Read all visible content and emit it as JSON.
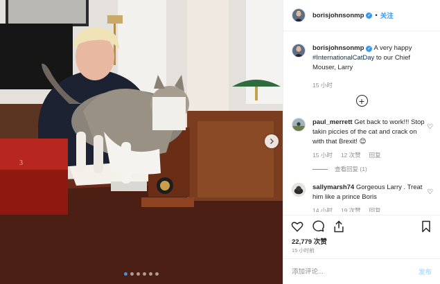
{
  "header": {
    "username": "borisjohnsonmp",
    "separator": "•",
    "follow_label": "关注"
  },
  "caption": {
    "username": "borisjohnsonmp",
    "text_before": "A very happy ",
    "hashtag": "#InternationalCatDay",
    "text_after": " to our Chief Mouser, Larry",
    "time": "15 小时"
  },
  "comments": [
    {
      "username": "paul_merrett",
      "text": "Get back to work!!! Stop takin piccies of the cat and crack on with that Brexit! ",
      "emoji": "😊",
      "time": "15 小时",
      "likes": "12 次赞",
      "reply_label": "回复",
      "view_replies": "查看回复 (1)"
    },
    {
      "username": "sallymarsh74",
      "text": "Gorgeous Larry . Treat him like a prince Boris",
      "time": "14 小时",
      "likes": "19 次赞",
      "reply_label": "回复"
    }
  ],
  "stats": {
    "likes": "22,779 次赞",
    "posted": "15 小时前"
  },
  "add_comment": {
    "placeholder": "添加评论...",
    "post_label": "发布"
  },
  "carousel": {
    "count": 6,
    "active_index": 0
  },
  "colors": {
    "accent": "#3897f0",
    "hashtag": "#003569",
    "muted": "#8e8e8e"
  },
  "icons": [
    "verified-badge-icon",
    "heart-icon",
    "comment-icon",
    "share-icon",
    "bookmark-icon",
    "plus-circle-icon",
    "chevron-right-icon"
  ]
}
